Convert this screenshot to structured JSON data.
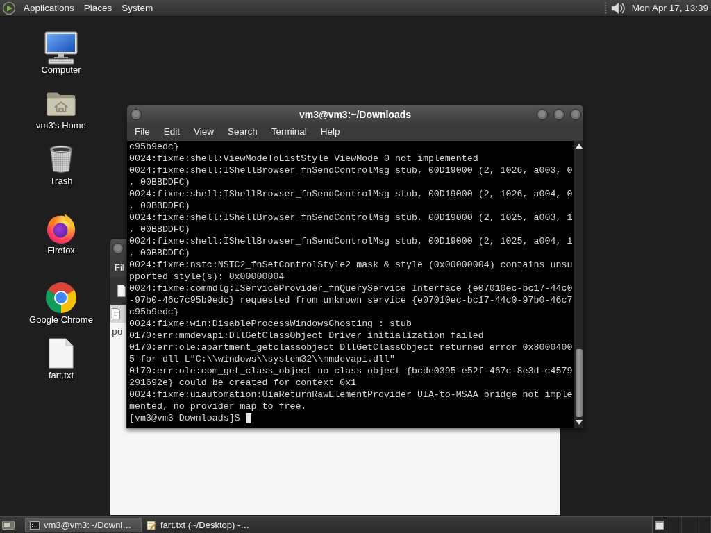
{
  "top_panel": {
    "menus": [
      "Applications",
      "Places",
      "System"
    ],
    "clock": "Mon Apr 17, 13:39"
  },
  "desktop_icons": [
    {
      "label": "Computer",
      "kind": "computer"
    },
    {
      "label": "vm3's Home",
      "kind": "home"
    },
    {
      "label": "Trash",
      "kind": "trash"
    },
    {
      "label": "Firefox",
      "kind": "firefox"
    },
    {
      "label": "Google Chrome",
      "kind": "chrome"
    },
    {
      "label": "fart.txt",
      "kind": "text-file"
    }
  ],
  "editor_window": {
    "menus": [
      "Fil"
    ],
    "text": "po"
  },
  "terminal_window": {
    "title": "vm3@vm3:~/Downloads",
    "menus": [
      "File",
      "Edit",
      "View",
      "Search",
      "Terminal",
      "Help"
    ],
    "lines": [
      "c95b9edc}",
      "0024:fixme:shell:ViewModeToListStyle ViewMode 0 not implemented",
      "0024:fixme:shell:IShellBrowser_fnSendControlMsg stub, 00D19000 (2, 1026, a003, 0",
      ", 00BBDDFC)",
      "0024:fixme:shell:IShellBrowser_fnSendControlMsg stub, 00D19000 (2, 1026, a004, 0",
      ", 00BBDDFC)",
      "0024:fixme:shell:IShellBrowser_fnSendControlMsg stub, 00D19000 (2, 1025, a003, 1",
      ", 00BBDDFC)",
      "0024:fixme:shell:IShellBrowser_fnSendControlMsg stub, 00D19000 (2, 1025, a004, 1",
      ", 00BBDDFC)",
      "0024:fixme:nstc:NSTC2_fnSetControlStyle2 mask & style (0x00000004) contains unsu",
      "pported style(s): 0x00000004",
      "0024:fixme:commdlg:IServiceProvider_fnQueryService Interface {e07010ec-bc17-44c0",
      "-97b0-46c7c95b9edc} requested from unknown service {e07010ec-bc17-44c0-97b0-46c7",
      "c95b9edc}",
      "0024:fixme:win:DisableProcessWindowsGhosting : stub",
      "0170:err:mmdevapi:DllGetClassObject Driver initialization failed",
      "0170:err:ole:apartment_getclassobject DllGetClassObject returned error 0x8000400",
      "5 for dll L\"C:\\\\windows\\\\system32\\\\mmdevapi.dll\"",
      "0170:err:ole:com_get_class_object no class object {bcde0395-e52f-467c-8e3d-c4579",
      "291692e} could be created for context 0x1",
      "0024:fixme:uiautomation:UiaReturnRawElementProvider UIA-to-MSAA bridge not imple",
      "mented, no provider map to free."
    ],
    "prompt": "[vm3@vm3 Downloads]$"
  },
  "taskbar": {
    "tasks": [
      {
        "label": "vm3@vm3:~/Downl…",
        "kind": "terminal",
        "selected": true
      },
      {
        "label": "fart.txt (~/Desktop) -…",
        "kind": "editor",
        "selected": false
      }
    ]
  }
}
